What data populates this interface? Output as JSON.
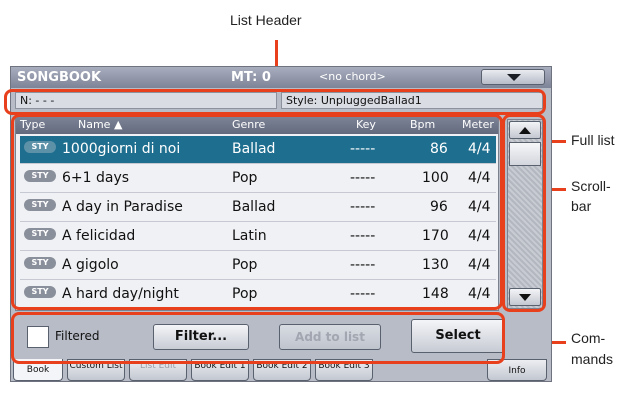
{
  "annotations": {
    "list_header": "List Header",
    "full_list": "Full list",
    "scroll_bar_line1": "Scroll-",
    "scroll_bar_line2": "bar",
    "commands_line1": "Com-",
    "commands_line2": "mands"
  },
  "titlebar": {
    "title": "SONGBOOK",
    "mt": "MT: 0",
    "chord": "<no chord>",
    "menu_icon": "menu-arrow-icon"
  },
  "info": {
    "n_field": "N: - - -",
    "style_field": "Style: UnpluggedBallad1"
  },
  "list": {
    "columns": [
      "Type",
      "Name ▲",
      "Genre",
      "Key",
      "Bpm",
      "Meter"
    ],
    "rows": [
      {
        "type": "STY",
        "name": "1000giorni di noi",
        "genre": "Ballad",
        "key": "-----",
        "bpm": "86",
        "meter": "4/4",
        "selected": true
      },
      {
        "type": "STY",
        "name": "6+1 days",
        "genre": "Pop",
        "key": "-----",
        "bpm": "100",
        "meter": "4/4",
        "selected": false
      },
      {
        "type": "STY",
        "name": "A day in Paradise",
        "genre": "Ballad",
        "key": "-----",
        "bpm": "96",
        "meter": "4/4",
        "selected": false
      },
      {
        "type": "STY",
        "name": "A felicidad",
        "genre": "Latin",
        "key": "-----",
        "bpm": "170",
        "meter": "4/4",
        "selected": false
      },
      {
        "type": "STY",
        "name": "A gigolo",
        "genre": "Pop",
        "key": "-----",
        "bpm": "130",
        "meter": "4/4",
        "selected": false
      },
      {
        "type": "STY",
        "name": "A hard day/night",
        "genre": "Pop",
        "key": "-----",
        "bpm": "148",
        "meter": "4/4",
        "selected": false
      }
    ]
  },
  "commands": {
    "filtered_label": "Filtered",
    "filter_button": "Filter...",
    "add_to_list_button": "Add to list",
    "select_button": "Select"
  },
  "tabs": [
    {
      "label": "Book",
      "active": true,
      "enabled": true
    },
    {
      "label": "Custom List",
      "active": false,
      "enabled": true
    },
    {
      "label": "List Edit",
      "active": false,
      "enabled": false
    },
    {
      "label": "Book Edit 1",
      "active": false,
      "enabled": true
    },
    {
      "label": "Book Edit 2",
      "active": false,
      "enabled": true
    },
    {
      "label": "Book Edit 3",
      "active": false,
      "enabled": true
    },
    {
      "label": "Info",
      "active": false,
      "enabled": true
    }
  ],
  "colors": {
    "callout": "#e8401c",
    "selected_row": "#1e6e8f",
    "titlebar": "#8a90a3"
  }
}
